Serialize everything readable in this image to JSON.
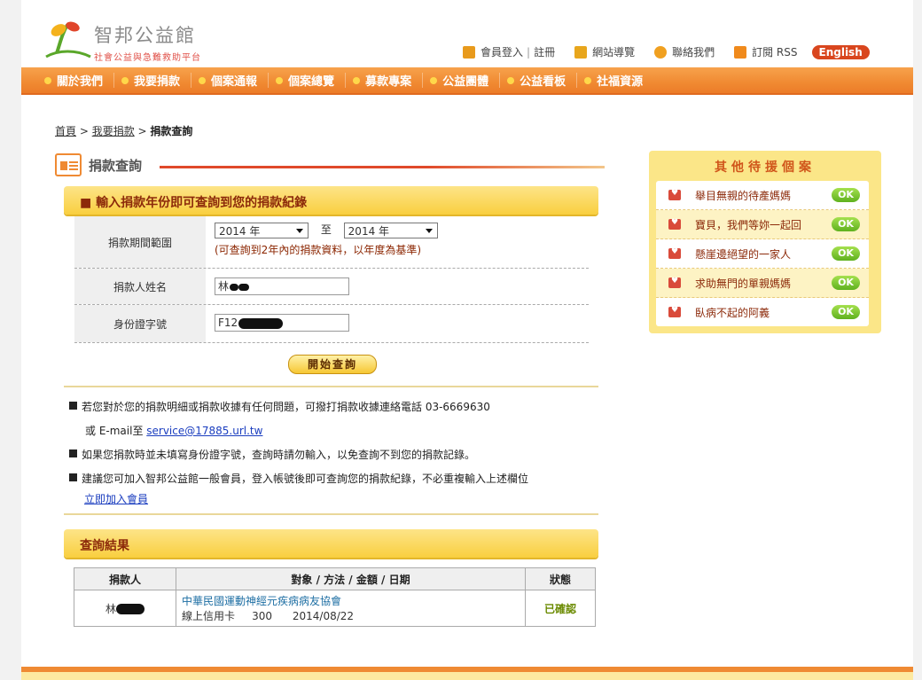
{
  "header": {
    "site_name": "智邦公益館",
    "site_sub": "社會公益與急難救助平台",
    "links": {
      "member_login": "會員登入",
      "register": "註冊",
      "sitemap": "網站導覽",
      "contact": "聯絡我們",
      "rss": "訂閱 RSS",
      "english": "English"
    }
  },
  "nav": [
    "關於我們",
    "我要捐款",
    "個案通報",
    "個案總覽",
    "募款專案",
    "公益團體",
    "公益看板",
    "社福資源"
  ],
  "breadcrumb": {
    "home": "首頁",
    "donate": "我要捐款",
    "current": "捐款查詢"
  },
  "section_title": "捐款查詢",
  "query_bar": "■ 輸入捐款年份即可查詢到您的捐款紀錄",
  "form": {
    "period_label": "捐款期間範圍",
    "from_year": "2014 年",
    "to_text": "至",
    "to_year": "2014 年",
    "hint": "(可查詢到2年內的捐款資料，以年度為基準)",
    "name_label": "捐款人姓名",
    "name_value": "林",
    "id_label": "身份證字號",
    "id_value": "F12",
    "submit": "開始查詢"
  },
  "notes": {
    "n1a": "若您對於您的捐款明細或捐款收據有任何問題，可撥打捐款收據連絡電話 03-6669630",
    "n1b_prefix": "或 E-mail至 ",
    "n1b_email": "service@17885.url.tw",
    "n2": "如果您捐款時並未填寫身份證字號，查詢時請勿輸入，以免查詢不到您的捐款記錄。",
    "n3": "建議您可加入智邦公益館一般會員，登入帳號後即可查詢您的捐款紀錄，不必重複輸入上述欄位",
    "join": "立即加入會員"
  },
  "result_bar": "查詢結果",
  "result_table": {
    "headers": [
      "捐款人",
      "對象 / 方法 / 金額 / 日期",
      "狀態"
    ],
    "rows": [
      {
        "donor": "林",
        "org": "中華民國運動神經元疾病病友協會",
        "method": "線上信用卡",
        "amount": "300",
        "date": "2014/08/22",
        "status": "已確認"
      }
    ]
  },
  "side": {
    "title": "其他待援個案",
    "items": [
      {
        "text": "舉目無親的待產媽媽",
        "btn": "OK"
      },
      {
        "text": "寶貝，我們等妳一起回",
        "btn": "OK"
      },
      {
        "text": "懸崖邊絕望的一家人",
        "btn": "OK"
      },
      {
        "text": "求助無門的單親媽媽",
        "btn": "OK"
      },
      {
        "text": "臥病不起的阿義",
        "btn": "OK"
      }
    ]
  }
}
